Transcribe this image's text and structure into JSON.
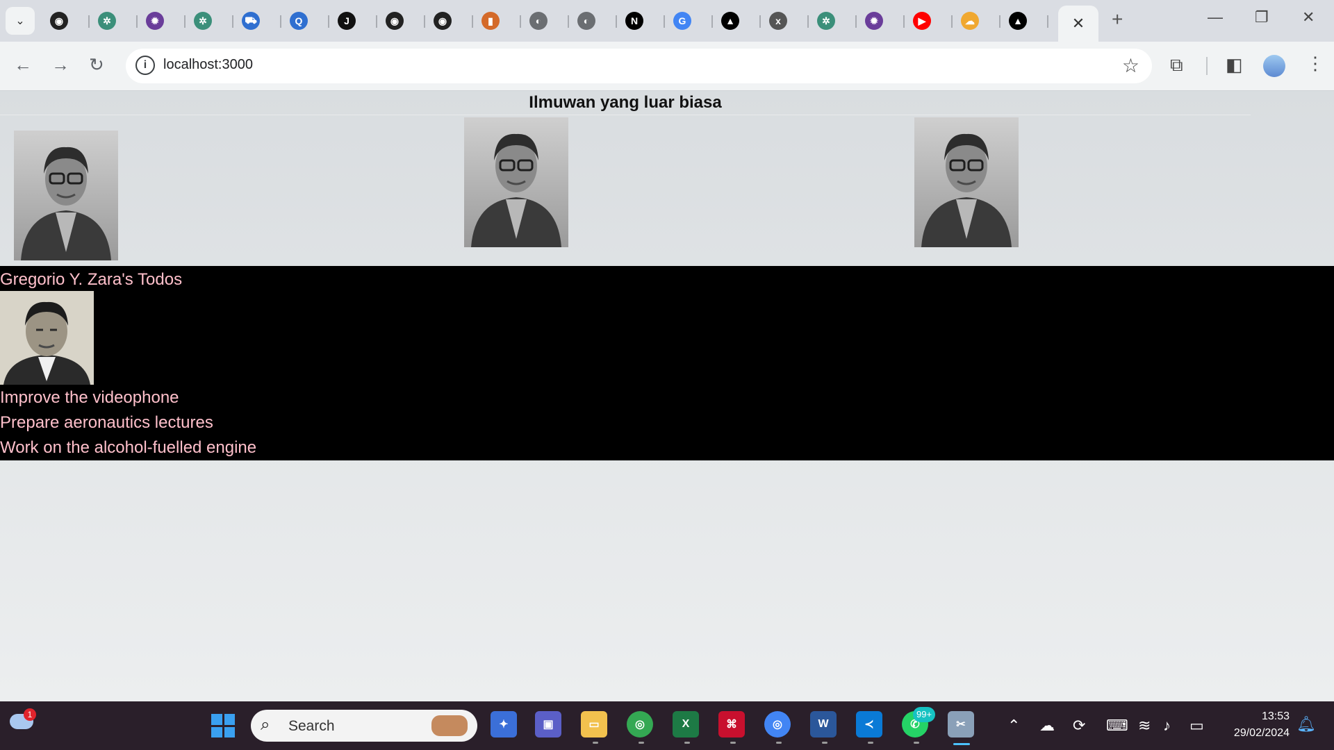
{
  "browser": {
    "address": "localhost:3000",
    "pinned_tabs": [
      {
        "icon": "github-icon",
        "glyph": "◉",
        "bg": "#222222"
      },
      {
        "icon": "chatgpt-icon",
        "glyph": "✲",
        "bg": "#3b8f7a"
      },
      {
        "icon": "university-icon",
        "glyph": "✹",
        "bg": "#6a3d9a"
      },
      {
        "icon": "chatgpt-icon",
        "glyph": "✲",
        "bg": "#3b8f7a"
      },
      {
        "icon": "cart-icon",
        "glyph": "⛟",
        "bg": "#2f6fd0"
      },
      {
        "icon": "search-icon",
        "glyph": "Q",
        "bg": "#2f6fd0"
      },
      {
        "icon": "j-icon",
        "glyph": "J",
        "bg": "#111111"
      },
      {
        "icon": "github-icon",
        "glyph": "◉",
        "bg": "#222222"
      },
      {
        "icon": "github-icon",
        "glyph": "◉",
        "bg": "#222222"
      },
      {
        "icon": "highlight-icon",
        "glyph": "▮",
        "bg": "#d46a2a"
      },
      {
        "icon": "globe-icon",
        "glyph": "◐",
        "bg": "#6b6e72"
      },
      {
        "icon": "globe-icon",
        "glyph": "◐",
        "bg": "#6b6e72"
      },
      {
        "icon": "nextjs-icon",
        "glyph": "N",
        "bg": "#000000"
      },
      {
        "icon": "google-icon",
        "glyph": "G",
        "bg": "#4285f4"
      },
      {
        "icon": "vercel-icon",
        "glyph": "▲",
        "bg": "#000000"
      },
      {
        "icon": "x-icon",
        "glyph": "x",
        "bg": "#555555"
      },
      {
        "icon": "chatgpt-icon",
        "glyph": "✲",
        "bg": "#3b8f7a"
      },
      {
        "icon": "university-icon",
        "glyph": "✹",
        "bg": "#6a3d9a"
      },
      {
        "icon": "youtube-icon",
        "glyph": "▶",
        "bg": "#ff0000"
      },
      {
        "icon": "cloud-icon",
        "glyph": "☁",
        "bg": "#f0a830"
      },
      {
        "icon": "vercel-icon",
        "glyph": "▲",
        "bg": "#000000"
      }
    ]
  },
  "page": {
    "heading": "Ilmuwan yang luar biasa",
    "card_title": "Gregorio Y. Zara's Todos",
    "todos": [
      "Improve the videophone",
      "Prepare aeronautics lectures",
      "Work on the alcohol-fuelled engine"
    ],
    "colors": {
      "card_bg": "#000000",
      "card_text": "#ffc0cb"
    }
  },
  "taskbar": {
    "search_label": "Search",
    "weather_badge": "1",
    "notification_badge": "99+",
    "time": "13:53",
    "date": "29/02/2024"
  }
}
